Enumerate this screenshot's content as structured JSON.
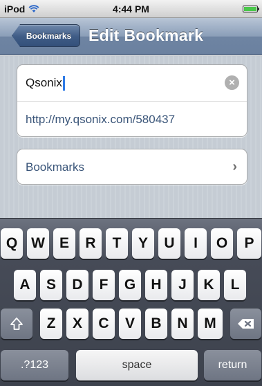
{
  "status_bar": {
    "carrier": "iPod",
    "wifi_icon": "wifi-icon",
    "time": "4:44 PM",
    "battery_icon": "battery-icon",
    "battery_level": 1.0
  },
  "nav_bar": {
    "back_label": "Bookmarks",
    "title": "Edit Bookmark"
  },
  "bookmark": {
    "title_value": "Qsonix",
    "url_value": "http://my.qsonix.com/580437",
    "folder_label": "Bookmarks",
    "clear_icon": "clear-icon",
    "chevron_icon": "chevron-right-icon"
  },
  "keyboard": {
    "row1": [
      "Q",
      "W",
      "E",
      "R",
      "T",
      "Y",
      "U",
      "I",
      "O",
      "P"
    ],
    "row2": [
      "A",
      "S",
      "D",
      "F",
      "G",
      "H",
      "J",
      "K",
      "L"
    ],
    "row3": [
      "Z",
      "X",
      "C",
      "V",
      "B",
      "N",
      "M"
    ],
    "shift_icon": "shift-icon",
    "delete_icon": "delete-icon",
    "numbers_label": ".?123",
    "space_label": "space",
    "return_label": "return"
  },
  "colors": {
    "nav_bar": "#6e84a2",
    "link_text": "#3a5579",
    "cursor": "#2f7be6"
  }
}
